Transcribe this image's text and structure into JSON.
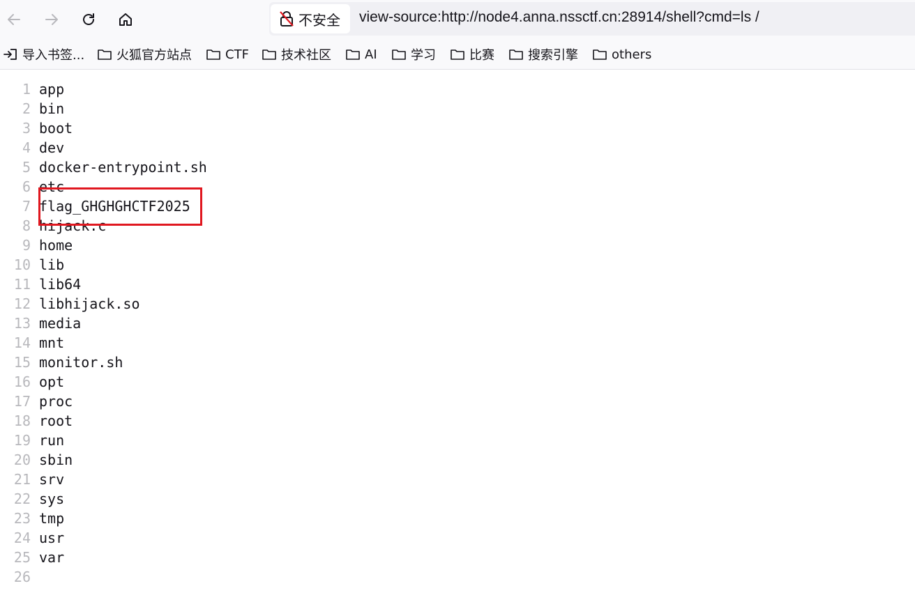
{
  "browser": {
    "security_label": "不安全",
    "url": "view-source:http://node4.anna.nssctf.cn:28914/shell?cmd=ls /",
    "bookmarks": [
      {
        "label": "导入书签...",
        "icon": "import-icon"
      },
      {
        "label": "火狐官方站点",
        "icon": "folder-icon"
      },
      {
        "label": "CTF",
        "icon": "folder-icon"
      },
      {
        "label": "技术社区",
        "icon": "folder-icon"
      },
      {
        "label": "AI",
        "icon": "folder-icon"
      },
      {
        "label": "学习",
        "icon": "folder-icon"
      },
      {
        "label": "比赛",
        "icon": "folder-icon"
      },
      {
        "label": "搜索引擎",
        "icon": "folder-icon"
      },
      {
        "label": "others",
        "icon": "folder-icon"
      }
    ]
  },
  "source": {
    "lines": [
      {
        "no": "1",
        "text": "app"
      },
      {
        "no": "2",
        "text": "bin"
      },
      {
        "no": "3",
        "text": "boot"
      },
      {
        "no": "4",
        "text": "dev"
      },
      {
        "no": "5",
        "text": "docker-entrypoint.sh"
      },
      {
        "no": "6",
        "text": "etc"
      },
      {
        "no": "7",
        "text": "flag_GHGHGHCTF2025"
      },
      {
        "no": "8",
        "text": "hijack.c"
      },
      {
        "no": "9",
        "text": "home"
      },
      {
        "no": "10",
        "text": "lib"
      },
      {
        "no": "11",
        "text": "lib64"
      },
      {
        "no": "12",
        "text": "libhijack.so"
      },
      {
        "no": "13",
        "text": "media"
      },
      {
        "no": "14",
        "text": "mnt"
      },
      {
        "no": "15",
        "text": "monitor.sh"
      },
      {
        "no": "16",
        "text": "opt"
      },
      {
        "no": "17",
        "text": "proc"
      },
      {
        "no": "18",
        "text": "root"
      },
      {
        "no": "19",
        "text": "run"
      },
      {
        "no": "20",
        "text": "sbin"
      },
      {
        "no": "21",
        "text": "srv"
      },
      {
        "no": "22",
        "text": "sys"
      },
      {
        "no": "23",
        "text": "tmp"
      },
      {
        "no": "24",
        "text": "usr"
      },
      {
        "no": "25",
        "text": "var"
      },
      {
        "no": "26",
        "text": ""
      }
    ],
    "highlighted_line": "7"
  },
  "colors": {
    "highlight": "#e0171f",
    "line_number": "#b8b8bc",
    "text": "#15141a"
  }
}
